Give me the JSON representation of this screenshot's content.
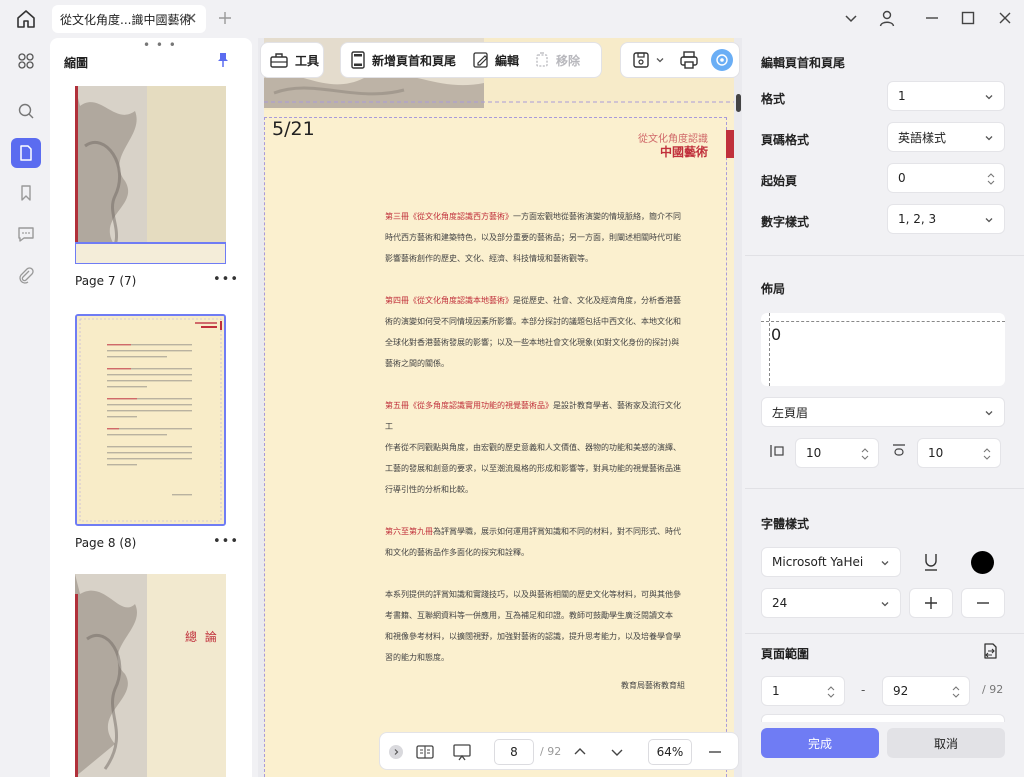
{
  "window": {
    "tab_title": "從文化角度...識中國藝術"
  },
  "thumbnails": {
    "title": "縮圖",
    "pages": [
      {
        "label": "Page 7 (7)"
      },
      {
        "label": "Page 8 (8)"
      },
      {
        "label": "總 論"
      }
    ]
  },
  "toolbar": {
    "tools_label": "工具",
    "add_header_label": "新增頁首和頁尾",
    "edit_label": "編輯",
    "remove_label": "移除"
  },
  "page": {
    "header_text": "5/21",
    "corner_line1": "從文化角度認識",
    "corner_line2": "中國藝術",
    "paragraphs": [
      {
        "red": "第三冊《從文化角度認識西方藝術》",
        "lines": [
          "一方面宏觀地從藝術演變的情境脈絡，簡介不同",
          "時代西方藝術和建築特色，以及部分重要的藝術品；另一方面，則闡述相關時代可能",
          "影響藝術創作的歷史、文化、經濟、科技情境和藝術觀等。"
        ]
      },
      {
        "red": "第四冊《從文化角度認識本地藝術》",
        "lines": [
          "是從歷史、社會、文化及經濟角度，分析香港藝",
          "術的演變如何受不同情境因素所影響。本部分探討的議題包括中西文化、本地文化和",
          "全球化對香港藝術發展的影響；以及一些本地社會文化現象(如對文化身份的探討)與",
          "藝術之間的關係。"
        ]
      },
      {
        "red": "第五冊《從多角度認識實用功能的視覺藝術品》",
        "lines": [
          "是設計教育學者、藝術家及流行文化工",
          "作者從不同觀點與角度，由宏觀的歷史意義和人文價值、器物的功能和美感的演繹、",
          "工藝的發展和創意的要求，以至潮流風格的形成和影響等，對具功能的視覺藝術品進",
          "行導引性的分析和比較。"
        ]
      },
      {
        "red": "第六至第九冊",
        "lines": [
          "為評賞學職，展示如何運用評賞知識和不同的材料，對不同形式、時代",
          "和文化的藝術品作多面化的探究和詮釋。"
        ]
      },
      {
        "red": "",
        "lines": [
          "本系列提供的評賞知識和實踐技巧，以及與藝術相關的歷史文化等材料，可與其他參",
          "考書籍、互聯網資料等一併應用，互為補足和印證。教師可鼓勵學生廣泛閱讀文本",
          "和視像參考材料，以擴闊視野，加強對藝術的認識，提升思考能力，以及培養學會學",
          "習的能力和態度。"
        ]
      }
    ],
    "signature": "教育局藝術教育組"
  },
  "bottombar": {
    "page_value": "8",
    "page_total": "/ 92",
    "zoom": "64%"
  },
  "panel": {
    "title": "編輯頁首和頁尾",
    "format_label": "格式",
    "format_value": "1",
    "page_format_label": "頁碼格式",
    "page_format_value": "英語樣式",
    "start_page_label": "起始頁",
    "start_page_value": "0",
    "number_style_label": "數字樣式",
    "number_style_value": "1, 2, 3",
    "layout_title": "佈局",
    "layout_preview_value": "0",
    "position_value": "左頁眉",
    "margin_left_value": "10",
    "margin_top_value": "10",
    "font_title": "字體樣式",
    "font_family_value": "Microsoft YaHei",
    "font_size_value": "24",
    "font_color": "#000000",
    "range_title": "頁面範圍",
    "range_from": "1",
    "range_dash": "-",
    "range_to": "92",
    "range_total": "/ 92",
    "done_label": "完成",
    "cancel_label": "取消",
    "accent": "#6f7cf4"
  }
}
